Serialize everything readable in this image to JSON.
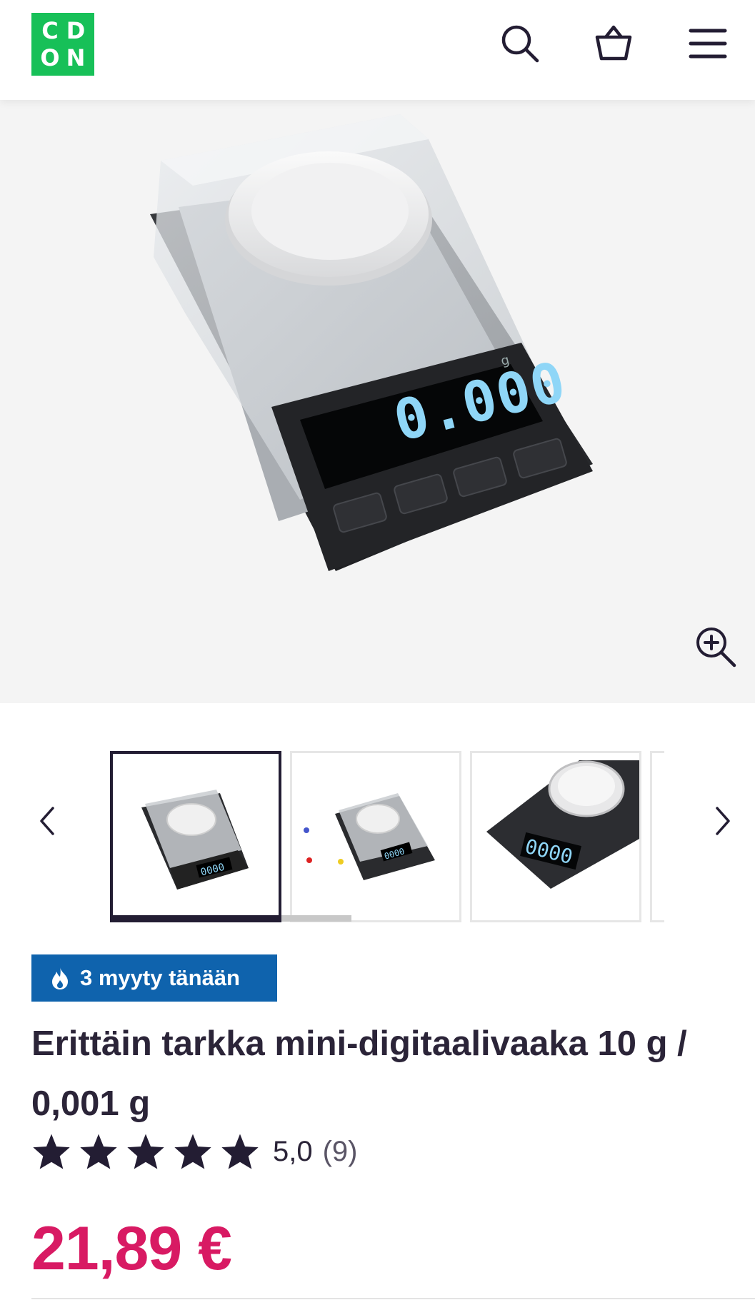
{
  "header": {
    "logo_letters": [
      "C",
      "D",
      "O",
      "N"
    ],
    "icons": [
      "search-icon",
      "basket-icon",
      "menu-icon"
    ]
  },
  "gallery": {
    "display_value": "0.000",
    "display_unit": "g",
    "thumb_count_visible": 3,
    "active_thumb_index": 0
  },
  "badge": {
    "text": "3 myyty tänään",
    "icon": "flame-icon"
  },
  "product": {
    "title": "Erittäin tarkka mini-digitaalivaaka 10 g / 0,001 g",
    "rating_value": "5,0",
    "rating_count": "(9)",
    "stars": 5,
    "price": "21,89 €"
  },
  "colors": {
    "brand_green": "#17c058",
    "badge_blue": "#0f63ad",
    "price_pink": "#d81a63",
    "text_dark": "#2b2438"
  }
}
